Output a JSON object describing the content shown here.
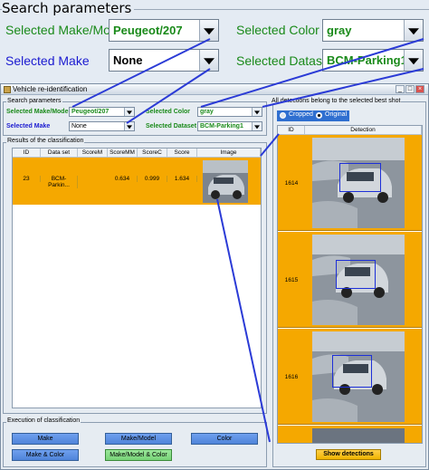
{
  "zoom": {
    "title": "Search parameters",
    "make_model_label": "Selected Make/Model",
    "make_model_value": "Peugeot/207",
    "color_label": "Selected Color",
    "color_value": "gray",
    "make_label": "Selected Make",
    "make_value": "None",
    "dataset_label": "Selected Dataset",
    "dataset_value": "BCM-Parking1"
  },
  "window": {
    "title": "Vehicle re-identification",
    "controls": [
      "_",
      "□",
      "×"
    ]
  },
  "search": {
    "group_label": "Search parameters",
    "make_model_label": "Selected Make/Model",
    "make_model_value": "Peugeot/207",
    "color_label": "Selected Color",
    "color_value": "gray",
    "make_label": "Selected Make",
    "make_value": "None",
    "dataset_label": "Selected Dataset",
    "dataset_value": "BCM-Parking1"
  },
  "results": {
    "group_label": "Results of the classification",
    "columns": [
      "ID",
      "Data set",
      "ScoreM",
      "ScoreMM",
      "ScoreC",
      "Score",
      "Image"
    ],
    "rows": [
      {
        "id": "23",
        "dataset": "BCM-Parkin...",
        "scoreM": "",
        "scoreMM": "0.634",
        "scoreC": "0.999",
        "score": "1.634"
      }
    ]
  },
  "execution": {
    "group_label": "Execution of classification",
    "buttons": [
      "Make",
      "Make/Model",
      "Color",
      "Make & Color",
      "Make/Model & Color"
    ]
  },
  "detections": {
    "group_label": "All detections belong to the selected best shot",
    "radio_cropped": "Cropped",
    "radio_original": "Original",
    "selected_radio": "Original",
    "columns": [
      "ID",
      "Detection"
    ],
    "rows": [
      {
        "id": "1614"
      },
      {
        "id": "1615"
      },
      {
        "id": "1616"
      }
    ],
    "show_button": "Show detections"
  },
  "colors": {
    "row_highlight": "#f5a800",
    "label_green": "#1a8a1a",
    "label_blue": "#1a1ad0",
    "connector": "#2b3bd6"
  }
}
